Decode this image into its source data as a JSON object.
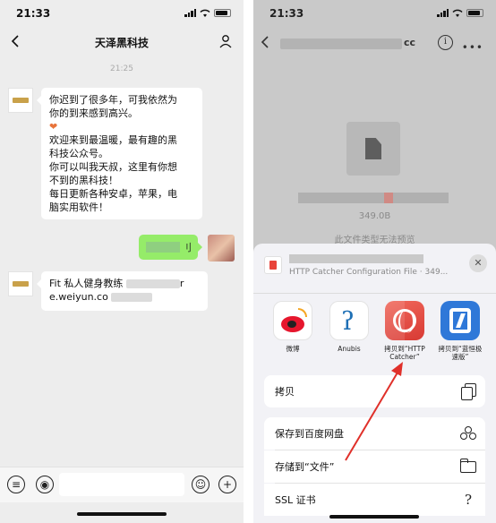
{
  "left": {
    "status_time": "21:33",
    "title": "天泽黑科技",
    "chat_time": "21:25",
    "msg1_lines": [
      "你迟到了很多年，可我依然为",
      "你的到来感到高兴。",
      "❤",
      "欢迎来到最温暖，最有趣的黑",
      "科技公众号。",
      "你可以叫我天叔，这里有你想",
      "不到的黑科技！",
      "每日更新各种安卓，苹果，电",
      "脑实用软件！"
    ],
    "green_tail": "刂",
    "msg2_line1": "Fit 私人健身教练",
    "msg2_line1_tail": "r",
    "msg2_line2": "e.weiyun.co"
  },
  "right": {
    "status_time": "21:33",
    "title_tail": "cc",
    "info_glyph": "i",
    "more_glyph": "•••",
    "file_size": "349.0B",
    "preview_msg": "此文件类型无法预览",
    "sheet_sub": "HTTP Catcher Configuration File · 349...",
    "close_glyph": "✕",
    "apps": [
      {
        "label": "微博"
      },
      {
        "label": "Anubis"
      },
      {
        "label": "拷贝到“HTTP\nCatcher”"
      },
      {
        "label": "拷贝到“蓝恒极\n速版”"
      }
    ],
    "actions": {
      "copy": "拷贝",
      "baidu": "保存到百度网盘",
      "files": "存储到“文件”",
      "ssl": "SSL 证书"
    },
    "ssl_glyph": "?"
  },
  "colors": {
    "wechat_green": "#95ec69",
    "annotation_red": "#e0302a",
    "httpcatcher_red": "#e04c43",
    "weibo_red": "#e6162d",
    "lanheng_blue": "#2f78d8"
  }
}
